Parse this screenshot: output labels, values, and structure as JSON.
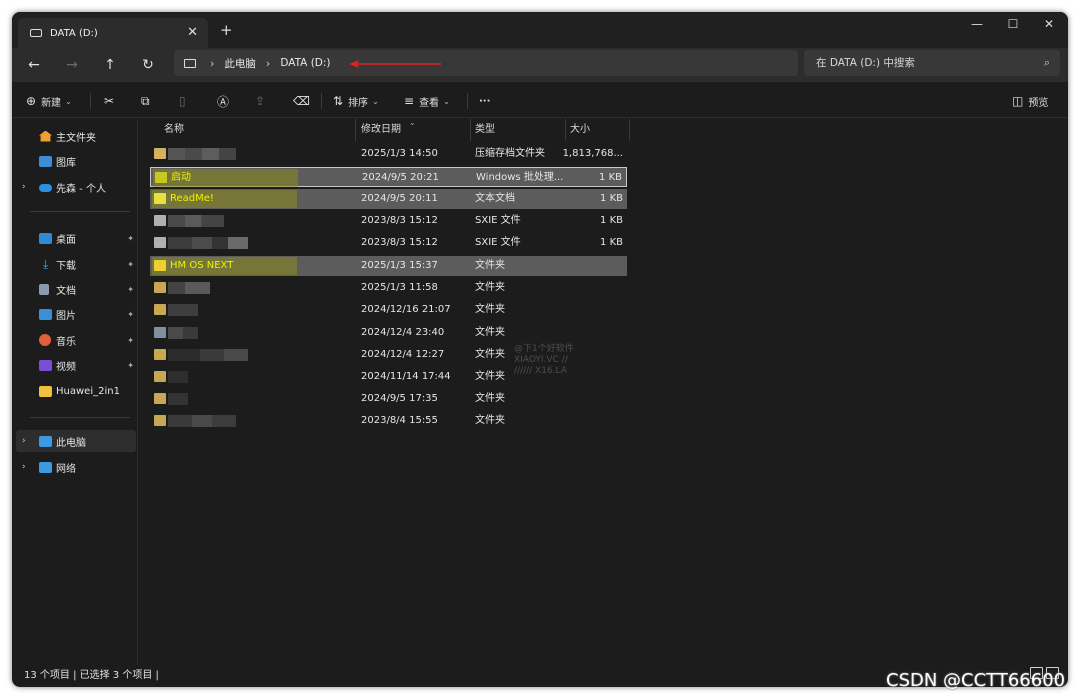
{
  "window": {
    "tab_title": "DATA (D:)",
    "tab_close": "✕",
    "new_tab": "+",
    "minimize": "—",
    "maximize": "☐",
    "close": "✕"
  },
  "nav": {
    "back": "←",
    "forward": "→",
    "up": "↑",
    "refresh": "↻",
    "breadcrumb": [
      "此电脑",
      "DATA (D:)"
    ],
    "breadcrumb_sep": "›",
    "search_placeholder": "在 DATA (D:) 中搜索",
    "search_icon": "⌕"
  },
  "toolbar": {
    "new_label": "新建",
    "sort_label": "排序",
    "view_label": "查看",
    "more_label": "···",
    "preview_label": "预览",
    "icons": {
      "new": "⊕",
      "cut": "✂",
      "copy": "⧉",
      "paste": "📋",
      "rename": "Ⓐ",
      "share": "⇪",
      "delete": "🗑",
      "sort": "⇅",
      "view": "≡",
      "preview": "◫"
    }
  },
  "sidebar": {
    "items": [
      {
        "label": "主文件夹",
        "icon": "home-icon",
        "color": "#f0a030"
      },
      {
        "label": "图库",
        "icon": "gallery-icon",
        "color": "#3b8fd6"
      },
      {
        "label": "先森 - 个人",
        "icon": "onedrive-icon",
        "color": "#2d8fe0"
      },
      {
        "label": "桌面",
        "icon": "desktop-icon",
        "color": "#2f8ad8"
      },
      {
        "label": "下载",
        "icon": "download-icon",
        "color": "#3aa8e8"
      },
      {
        "label": "文档",
        "icon": "documents-icon",
        "color": "#8a9ab0"
      },
      {
        "label": "图片",
        "icon": "pictures-icon",
        "color": "#3b8fd6"
      },
      {
        "label": "音乐",
        "icon": "music-icon",
        "color": "#e0603a"
      },
      {
        "label": "视频",
        "icon": "videos-icon",
        "color": "#7a4fd6"
      },
      {
        "label": "Huawei_2in1",
        "icon": "folder-icon",
        "color": "#f0c040"
      },
      {
        "label": "此电脑",
        "icon": "this-pc-icon",
        "color": "#3b9ae0"
      },
      {
        "label": "网络",
        "icon": "network-icon",
        "color": "#3b9ae0"
      }
    ],
    "pin": "📌",
    "chevron": "›"
  },
  "columns": {
    "name": "名称",
    "date": "修改日期",
    "type": "类型",
    "size": "大小",
    "sort_caret": "⌄"
  },
  "files": [
    {
      "name": "",
      "date": "2025/1/3 14:50",
      "type": "压缩存档文件夹",
      "size": "1,813,768...",
      "icon_color": "#d4b060"
    },
    {
      "name": "启动",
      "date": "2024/9/5 20:21",
      "type": "Windows 批处理...",
      "size": "1 KB",
      "icon_color": "#c8c820"
    },
    {
      "name": "ReadMe!",
      "date": "2024/9/5 20:11",
      "type": "文本文档",
      "size": "1 KB",
      "icon_color": "#e8e040"
    },
    {
      "name": "",
      "date": "2023/8/3 15:12",
      "type": "SXIE 文件",
      "size": "1 KB",
      "icon_color": "#b0b0b0"
    },
    {
      "name": "",
      "date": "2023/8/3 15:12",
      "type": "SXIE 文件",
      "size": "1 KB",
      "icon_color": "#b0b0b0"
    },
    {
      "name": "HM OS NEXT",
      "date": "2025/1/3 15:37",
      "type": "文件夹",
      "size": "",
      "icon_color": "#f0d030"
    },
    {
      "name": "",
      "date": "2025/1/3 11:58",
      "type": "文件夹",
      "size": "",
      "icon_color": "#c8a850"
    },
    {
      "name": "",
      "date": "2024/12/16 21:07",
      "type": "文件夹",
      "size": "",
      "icon_color": "#c8a850"
    },
    {
      "name": "",
      "date": "2024/12/4 23:40",
      "type": "文件夹",
      "size": "",
      "icon_color": "#8090a0"
    },
    {
      "name": "",
      "date": "2024/12/4 12:27",
      "type": "文件夹",
      "size": "",
      "icon_color": "#c8a850"
    },
    {
      "name": "",
      "date": "2024/11/14 17:44",
      "type": "文件夹",
      "size": "",
      "icon_color": "#c8a850"
    },
    {
      "name": "",
      "date": "2024/9/5 17:35",
      "type": "文件夹",
      "size": "",
      "icon_color": "#c8a850"
    },
    {
      "name": "",
      "date": "2023/8/4 15:55",
      "type": "文件夹",
      "size": "",
      "icon_color": "#c8a850"
    }
  ],
  "status": {
    "text": "13 个项目  |  已选择 3 个项目  |"
  },
  "watermarks": {
    "center_line1": "@下1个好软件",
    "center_line2": "XIAOYI.VC //",
    "center_line3": "////// X16.LA",
    "corner": "CSDN @CCTT66600"
  }
}
